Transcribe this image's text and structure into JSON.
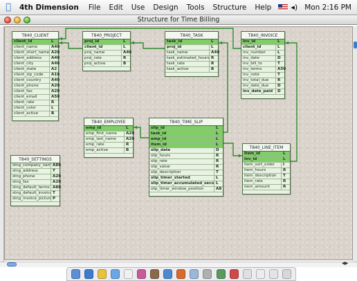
{
  "menubar": {
    "app_name": "4th Dimension",
    "items": [
      "File",
      "Edit",
      "Use",
      "Design",
      "Tools",
      "Structure",
      "Help"
    ],
    "clock": "Mon 2:16 PM"
  },
  "window": {
    "title": "Structure for Time Billing"
  },
  "tables": {
    "client": {
      "name": "T840_CLIENT",
      "fields": [
        {
          "n": "client_id",
          "t": "L",
          "key": true
        },
        {
          "n": "client_name",
          "t": "A40"
        },
        {
          "n": "client_short_name",
          "t": "A20"
        },
        {
          "n": "client_address",
          "t": "A40"
        },
        {
          "n": "client_city",
          "t": "A40"
        },
        {
          "n": "client_state",
          "t": "A2"
        },
        {
          "n": "client_zip_code",
          "t": "A10"
        },
        {
          "n": "client_country",
          "t": "A40"
        },
        {
          "n": "client_phone",
          "t": "A20"
        },
        {
          "n": "client_fax",
          "t": "A20"
        },
        {
          "n": "client_email",
          "t": "A50"
        },
        {
          "n": "client_rate",
          "t": "R"
        },
        {
          "n": "client_color",
          "t": "L"
        },
        {
          "n": "client_active",
          "t": "B"
        }
      ]
    },
    "project": {
      "name": "T840_PROJECT",
      "fields": [
        {
          "n": "proj_id",
          "t": "L",
          "key": true
        },
        {
          "n": "client_id",
          "t": "L",
          "bold": true
        },
        {
          "n": "proj_name",
          "t": "A40"
        },
        {
          "n": "proj_rate",
          "t": "R"
        },
        {
          "n": "proj_active",
          "t": "B"
        }
      ]
    },
    "task": {
      "name": "T840_TASK",
      "fields": [
        {
          "n": "task_id",
          "t": "L",
          "key": true
        },
        {
          "n": "proj_id",
          "t": "L",
          "bold": true
        },
        {
          "n": "task_name",
          "t": "A40"
        },
        {
          "n": "task_estimated_hours",
          "t": "R"
        },
        {
          "n": "task_rate",
          "t": "R"
        },
        {
          "n": "task_active",
          "t": "B"
        }
      ]
    },
    "invoice": {
      "name": "T840_INVOICE",
      "fields": [
        {
          "n": "inv_id",
          "t": "L",
          "key": true
        },
        {
          "n": "client_id",
          "t": "L",
          "bold": true
        },
        {
          "n": "inv_number",
          "t": "L"
        },
        {
          "n": "inv_date",
          "t": "D"
        },
        {
          "n": "inv_bill_to",
          "t": "T"
        },
        {
          "n": "inv_terms",
          "t": "A50"
        },
        {
          "n": "inv_note",
          "t": "T"
        },
        {
          "n": "inv_total_due",
          "t": "R"
        },
        {
          "n": "inv_date_due",
          "t": "D"
        },
        {
          "n": "inv_date_paid",
          "t": "D",
          "bold": true
        }
      ]
    },
    "employee": {
      "name": "T840_EMPLOYEE",
      "fields": [
        {
          "n": "emp_id",
          "t": "L",
          "key": true
        },
        {
          "n": "emp_first_name",
          "t": "A20"
        },
        {
          "n": "emp_last_name",
          "t": "A20"
        },
        {
          "n": "emp_rate",
          "t": "R"
        },
        {
          "n": "emp_active",
          "t": "B"
        }
      ]
    },
    "time_slip": {
      "name": "T840_TIME_SLIP",
      "fields": [
        {
          "n": "slip_id",
          "t": "L",
          "key": true
        },
        {
          "n": "task_id",
          "t": "L",
          "key": true
        },
        {
          "n": "emp_id",
          "t": "L",
          "key": true
        },
        {
          "n": "item_id",
          "t": "L",
          "key": true
        },
        {
          "n": "slip_date",
          "t": "D",
          "bold": true
        },
        {
          "n": "slip_hours",
          "t": "R"
        },
        {
          "n": "slip_rate",
          "t": "R"
        },
        {
          "n": "slip_value",
          "t": "R"
        },
        {
          "n": "slip_description",
          "t": "T"
        },
        {
          "n": "slip_timer_started",
          "t": "L",
          "bold": true
        },
        {
          "n": "slip_timer_accumulated_seconds",
          "t": "L",
          "bold": true
        },
        {
          "n": "slip_timer_window_position",
          "t": "A8"
        }
      ]
    },
    "settings": {
      "name": "T840_SETTINGS",
      "fields": [
        {
          "n": "stng_company_name",
          "t": "A80"
        },
        {
          "n": "stng_address",
          "t": "T"
        },
        {
          "n": "stng_phone",
          "t": "A20"
        },
        {
          "n": "stng_fax",
          "t": "A20"
        },
        {
          "n": "stng_default_terms",
          "t": "A80"
        },
        {
          "n": "stng_default_invoice_note",
          "t": "T"
        },
        {
          "n": "stng_invoice_picture",
          "t": "P"
        }
      ]
    },
    "line_item": {
      "name": "T840_LINE_ITEM",
      "fields": [
        {
          "n": "item_id",
          "t": "L",
          "key": true
        },
        {
          "n": "inv_id",
          "t": "L",
          "key": true
        },
        {
          "n": "item_sort_order",
          "t": "I"
        },
        {
          "n": "item_hours",
          "t": "R"
        },
        {
          "n": "item_description",
          "t": "T"
        },
        {
          "n": "item_rate",
          "t": "R"
        },
        {
          "n": "item_amount",
          "t": "R"
        }
      ]
    }
  },
  "colors": {
    "key_field": "#7fce66",
    "relation_line": "#2e8a2e",
    "table_bg": "#e8f3e2"
  }
}
